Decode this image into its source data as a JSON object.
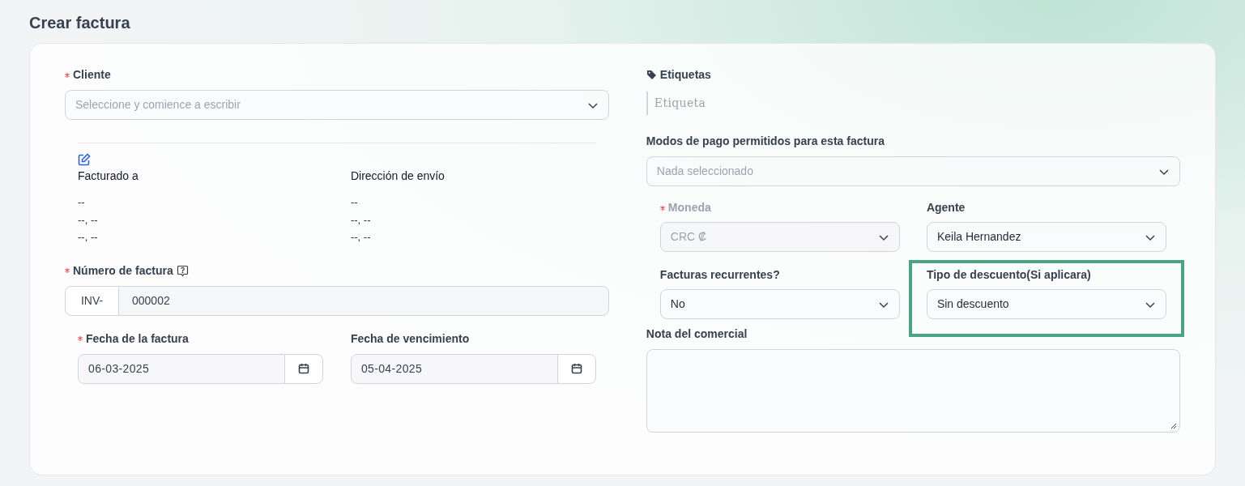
{
  "page": {
    "title": "Crear factura"
  },
  "client": {
    "label": "Cliente",
    "required": true,
    "placeholder": "Seleccione y comience a escribir"
  },
  "addresses": [
    {
      "heading": "Facturado a",
      "lines": [
        "--",
        "--, --",
        "--, --"
      ]
    },
    {
      "heading": "Dirección de envío",
      "lines": [
        "--",
        "--, --",
        "--, --"
      ]
    }
  ],
  "invoice_number": {
    "label": "Número de factura",
    "required": true,
    "prefix": "INV-",
    "value": "000002"
  },
  "dates": [
    {
      "label": "Fecha de la factura",
      "required": true,
      "value": "06-03-2025"
    },
    {
      "label": "Fecha de vencimiento",
      "required": false,
      "value": "05-04-2025"
    }
  ],
  "tags": {
    "label": "Etiquetas",
    "placeholder": "Etiqueta"
  },
  "payment_modes": {
    "label": "Modos de pago permitidos para esta factura",
    "placeholder": "Nada seleccionado"
  },
  "selects": [
    {
      "label": "Moneda",
      "required": true,
      "disabled": true,
      "highlighted": false,
      "value": "CRC ₡"
    },
    {
      "label": "Agente",
      "required": false,
      "disabled": false,
      "highlighted": false,
      "value": "Keila Hernandez"
    },
    {
      "label": "Facturas recurrentes?",
      "required": false,
      "disabled": false,
      "highlighted": false,
      "value": "No"
    },
    {
      "label": "Tipo de descuento(Si aplicara)",
      "required": false,
      "disabled": false,
      "highlighted": true,
      "value": "Sin descuento"
    }
  ],
  "note": {
    "label": "Nota del comercial"
  }
}
